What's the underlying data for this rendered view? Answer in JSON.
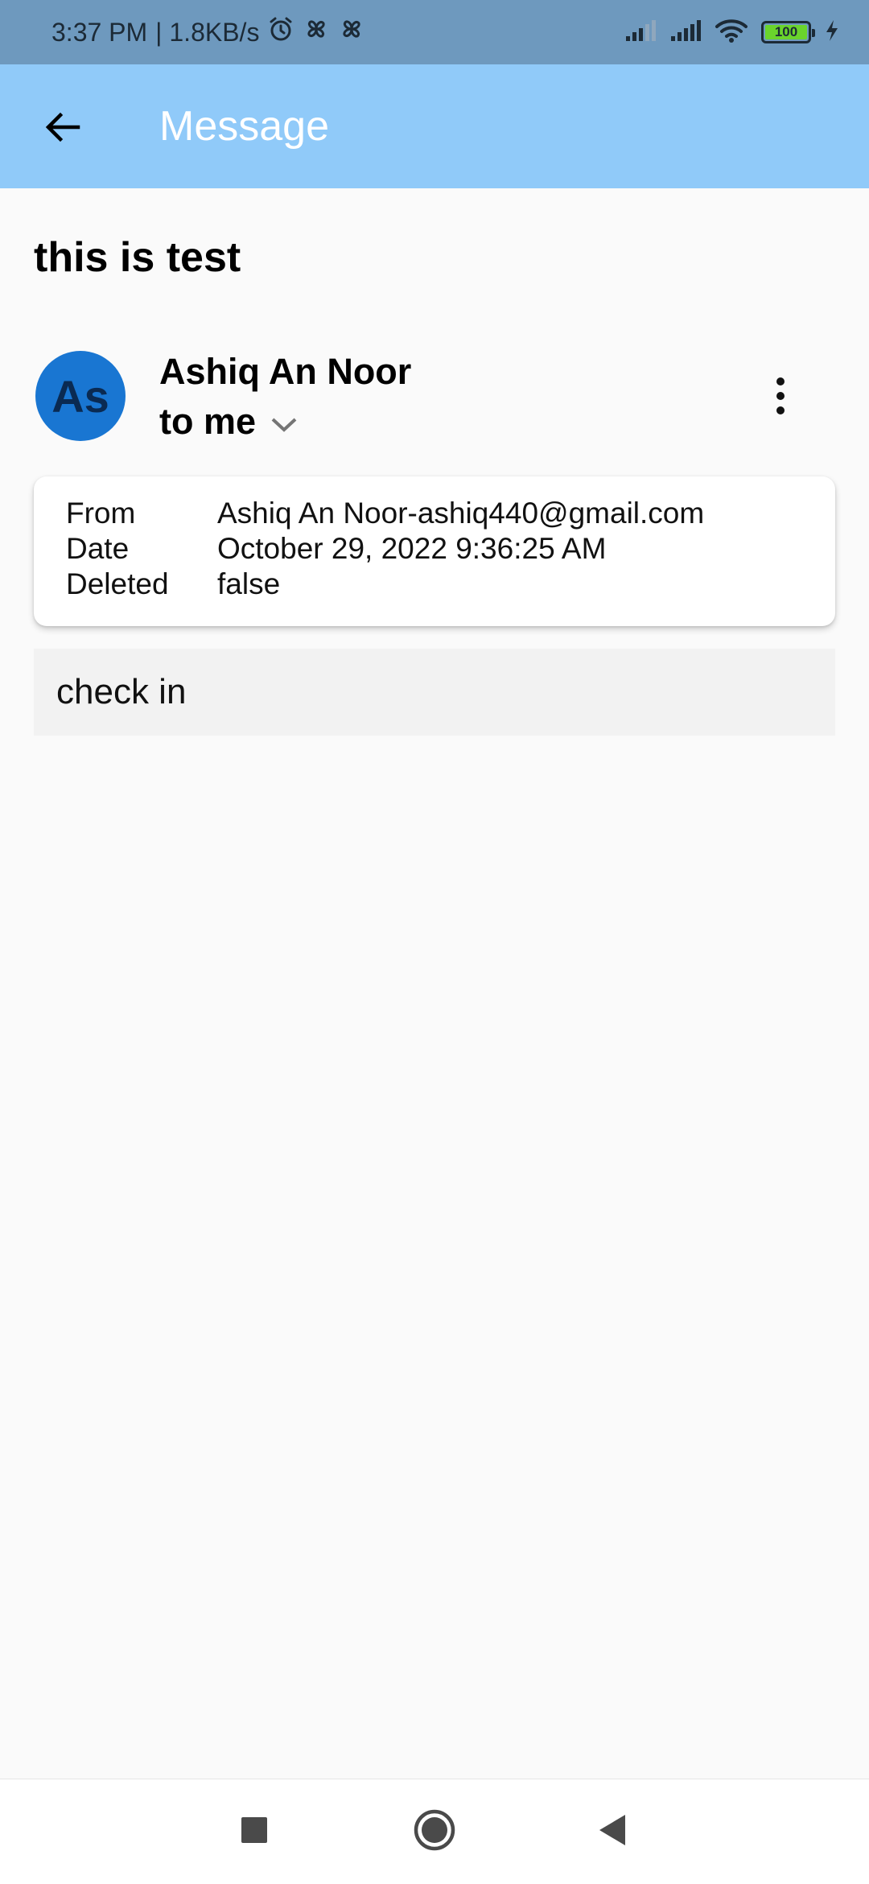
{
  "status_bar": {
    "time": "3:37 PM",
    "speed": "| 1.8KB/s",
    "battery_level": "100",
    "battery_fraction": 1.0
  },
  "app_bar": {
    "title": "Message",
    "back_icon": "arrow-back-icon"
  },
  "message": {
    "subject": "this is test",
    "avatar_initials": "As",
    "sender_name": "Ashiq An Noor",
    "recipient": "to me",
    "body": "check in"
  },
  "details": {
    "from_label": "From",
    "from_value": "Ashiq An Noor-ashiq440@gmail.com",
    "date_label": "Date",
    "date_value": "October 29, 2022 9:36:25 AM",
    "deleted_label": "Deleted",
    "deleted_value": "false"
  },
  "nav": {
    "recents_icon": "square-icon",
    "home_icon": "circle-icon",
    "back_icon": "triangle-back-icon"
  },
  "colors": {
    "status_bar_bg": "#6e99be",
    "app_bar_bg": "#90caf9",
    "avatar_bg": "#1976d2",
    "page_bg": "#fafafa",
    "body_bg": "#f2f2f2"
  }
}
